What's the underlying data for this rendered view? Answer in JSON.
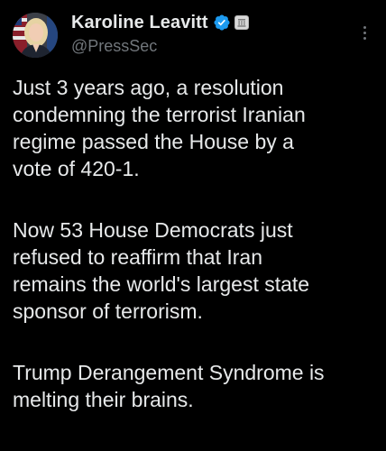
{
  "post": {
    "author": {
      "display_name": "Karoline Leavitt",
      "handle": "@PressSec",
      "verified": true,
      "verified_color": "#1d9bf0",
      "affiliate_badge": "government-seal-icon"
    },
    "more_icon": "more-options-icon",
    "paragraphs": [
      {
        "lines": [
          "Just 3 years ago, a resolution",
          "condemning the terrorist Iranian",
          "regime passed the House by a",
          "vote of 420-1."
        ]
      },
      {
        "lines": [
          "Now 53 House Democrats just",
          "refused to reaffirm that Iran",
          "remains the world's largest state",
          "sponsor of terrorism."
        ]
      },
      {
        "lines": [
          "Trump Derangement Syndrome is",
          "melting their brains."
        ]
      }
    ]
  },
  "colors": {
    "background": "#000000",
    "text_primary": "#e7e9ea",
    "text_secondary": "#71767b"
  }
}
